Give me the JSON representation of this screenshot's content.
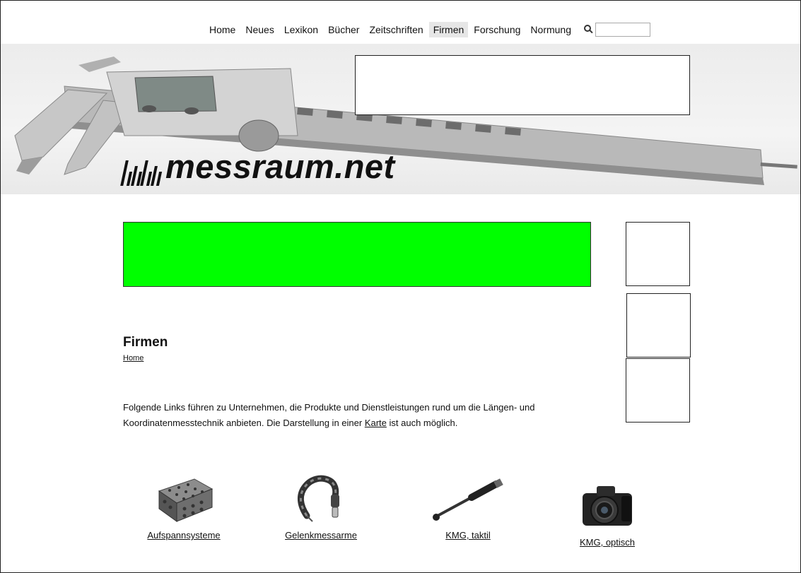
{
  "nav": {
    "items": [
      {
        "label": "Home",
        "active": false
      },
      {
        "label": "Neues",
        "active": false
      },
      {
        "label": "Lexikon",
        "active": false
      },
      {
        "label": "Bücher",
        "active": false
      },
      {
        "label": "Zeitschriften",
        "active": false
      },
      {
        "label": "Firmen",
        "active": true
      },
      {
        "label": "Forschung",
        "active": false
      },
      {
        "label": "Normung",
        "active": false
      }
    ],
    "search": {
      "value": "",
      "icon": "search-icon"
    }
  },
  "header": {
    "logo_text": "messraum.net",
    "banner_image": "digital-caliper"
  },
  "ads": {
    "green_color": "#00ff00"
  },
  "page": {
    "title": "Firmen",
    "breadcrumb": "Home",
    "intro_before_link": "Folgende Links führen zu Unternehmen, die Produkte und Dienstleistungen rund um die Längen- und Koordinatenmesstechnik anbieten. Die Darstellung in einer ",
    "intro_link": "Karte",
    "intro_after_link": " ist auch möglich."
  },
  "categories": [
    {
      "label": "Aufspannsysteme",
      "icon": "fixture-block-image"
    },
    {
      "label": "Gelenkmessarme",
      "icon": "articulated-arm-image"
    },
    {
      "label": "KMG, taktil",
      "icon": "probe-stylus-image"
    },
    {
      "label": "KMG, optisch",
      "icon": "camera-image"
    }
  ]
}
